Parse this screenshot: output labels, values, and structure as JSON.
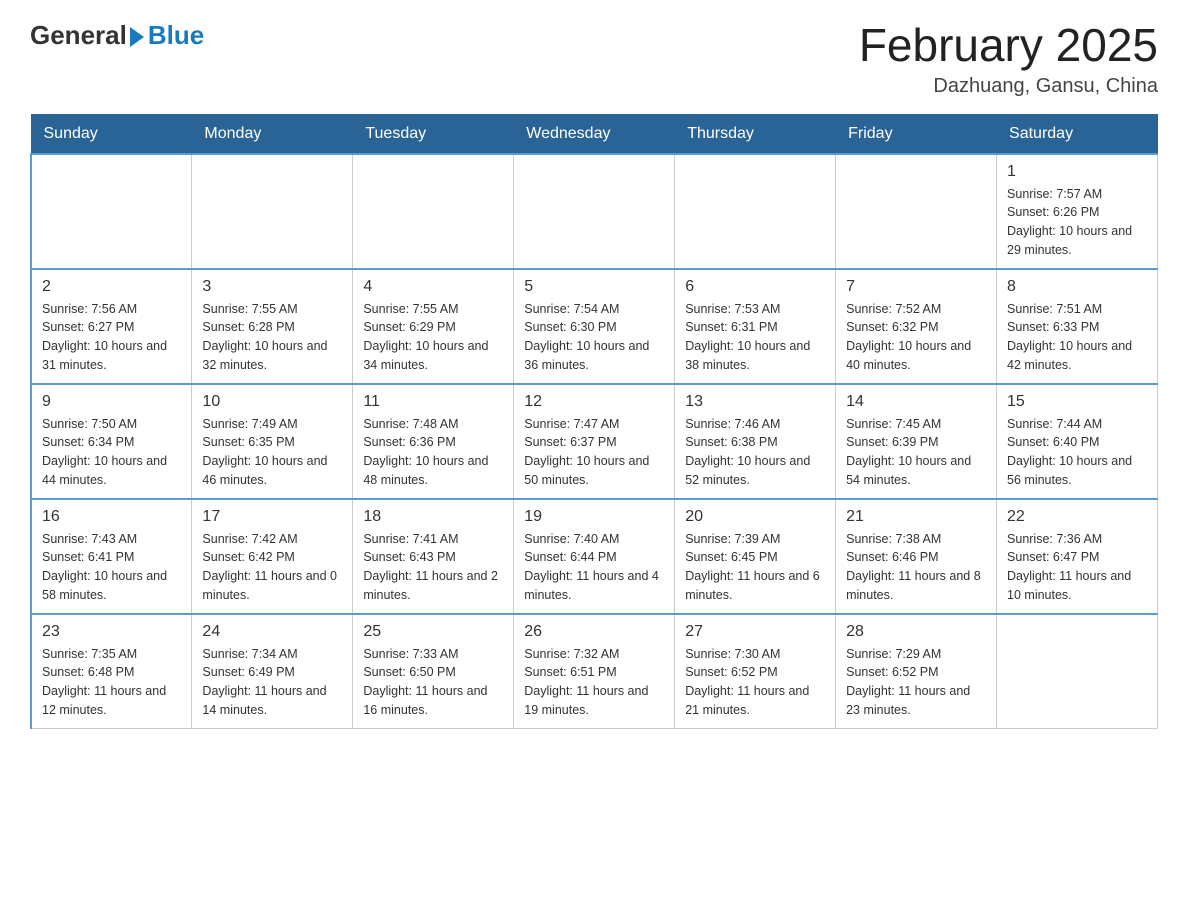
{
  "header": {
    "logo_general": "General",
    "logo_blue": "Blue",
    "month_year": "February 2025",
    "location": "Dazhuang, Gansu, China"
  },
  "weekdays": [
    "Sunday",
    "Monday",
    "Tuesday",
    "Wednesday",
    "Thursday",
    "Friday",
    "Saturday"
  ],
  "weeks": [
    [
      {
        "day": "",
        "sunrise": "",
        "sunset": "",
        "daylight": ""
      },
      {
        "day": "",
        "sunrise": "",
        "sunset": "",
        "daylight": ""
      },
      {
        "day": "",
        "sunrise": "",
        "sunset": "",
        "daylight": ""
      },
      {
        "day": "",
        "sunrise": "",
        "sunset": "",
        "daylight": ""
      },
      {
        "day": "",
        "sunrise": "",
        "sunset": "",
        "daylight": ""
      },
      {
        "day": "",
        "sunrise": "",
        "sunset": "",
        "daylight": ""
      },
      {
        "day": "1",
        "sunrise": "Sunrise: 7:57 AM",
        "sunset": "Sunset: 6:26 PM",
        "daylight": "Daylight: 10 hours and 29 minutes."
      }
    ],
    [
      {
        "day": "2",
        "sunrise": "Sunrise: 7:56 AM",
        "sunset": "Sunset: 6:27 PM",
        "daylight": "Daylight: 10 hours and 31 minutes."
      },
      {
        "day": "3",
        "sunrise": "Sunrise: 7:55 AM",
        "sunset": "Sunset: 6:28 PM",
        "daylight": "Daylight: 10 hours and 32 minutes."
      },
      {
        "day": "4",
        "sunrise": "Sunrise: 7:55 AM",
        "sunset": "Sunset: 6:29 PM",
        "daylight": "Daylight: 10 hours and 34 minutes."
      },
      {
        "day": "5",
        "sunrise": "Sunrise: 7:54 AM",
        "sunset": "Sunset: 6:30 PM",
        "daylight": "Daylight: 10 hours and 36 minutes."
      },
      {
        "day": "6",
        "sunrise": "Sunrise: 7:53 AM",
        "sunset": "Sunset: 6:31 PM",
        "daylight": "Daylight: 10 hours and 38 minutes."
      },
      {
        "day": "7",
        "sunrise": "Sunrise: 7:52 AM",
        "sunset": "Sunset: 6:32 PM",
        "daylight": "Daylight: 10 hours and 40 minutes."
      },
      {
        "day": "8",
        "sunrise": "Sunrise: 7:51 AM",
        "sunset": "Sunset: 6:33 PM",
        "daylight": "Daylight: 10 hours and 42 minutes."
      }
    ],
    [
      {
        "day": "9",
        "sunrise": "Sunrise: 7:50 AM",
        "sunset": "Sunset: 6:34 PM",
        "daylight": "Daylight: 10 hours and 44 minutes."
      },
      {
        "day": "10",
        "sunrise": "Sunrise: 7:49 AM",
        "sunset": "Sunset: 6:35 PM",
        "daylight": "Daylight: 10 hours and 46 minutes."
      },
      {
        "day": "11",
        "sunrise": "Sunrise: 7:48 AM",
        "sunset": "Sunset: 6:36 PM",
        "daylight": "Daylight: 10 hours and 48 minutes."
      },
      {
        "day": "12",
        "sunrise": "Sunrise: 7:47 AM",
        "sunset": "Sunset: 6:37 PM",
        "daylight": "Daylight: 10 hours and 50 minutes."
      },
      {
        "day": "13",
        "sunrise": "Sunrise: 7:46 AM",
        "sunset": "Sunset: 6:38 PM",
        "daylight": "Daylight: 10 hours and 52 minutes."
      },
      {
        "day": "14",
        "sunrise": "Sunrise: 7:45 AM",
        "sunset": "Sunset: 6:39 PM",
        "daylight": "Daylight: 10 hours and 54 minutes."
      },
      {
        "day": "15",
        "sunrise": "Sunrise: 7:44 AM",
        "sunset": "Sunset: 6:40 PM",
        "daylight": "Daylight: 10 hours and 56 minutes."
      }
    ],
    [
      {
        "day": "16",
        "sunrise": "Sunrise: 7:43 AM",
        "sunset": "Sunset: 6:41 PM",
        "daylight": "Daylight: 10 hours and 58 minutes."
      },
      {
        "day": "17",
        "sunrise": "Sunrise: 7:42 AM",
        "sunset": "Sunset: 6:42 PM",
        "daylight": "Daylight: 11 hours and 0 minutes."
      },
      {
        "day": "18",
        "sunrise": "Sunrise: 7:41 AM",
        "sunset": "Sunset: 6:43 PM",
        "daylight": "Daylight: 11 hours and 2 minutes."
      },
      {
        "day": "19",
        "sunrise": "Sunrise: 7:40 AM",
        "sunset": "Sunset: 6:44 PM",
        "daylight": "Daylight: 11 hours and 4 minutes."
      },
      {
        "day": "20",
        "sunrise": "Sunrise: 7:39 AM",
        "sunset": "Sunset: 6:45 PM",
        "daylight": "Daylight: 11 hours and 6 minutes."
      },
      {
        "day": "21",
        "sunrise": "Sunrise: 7:38 AM",
        "sunset": "Sunset: 6:46 PM",
        "daylight": "Daylight: 11 hours and 8 minutes."
      },
      {
        "day": "22",
        "sunrise": "Sunrise: 7:36 AM",
        "sunset": "Sunset: 6:47 PM",
        "daylight": "Daylight: 11 hours and 10 minutes."
      }
    ],
    [
      {
        "day": "23",
        "sunrise": "Sunrise: 7:35 AM",
        "sunset": "Sunset: 6:48 PM",
        "daylight": "Daylight: 11 hours and 12 minutes."
      },
      {
        "day": "24",
        "sunrise": "Sunrise: 7:34 AM",
        "sunset": "Sunset: 6:49 PM",
        "daylight": "Daylight: 11 hours and 14 minutes."
      },
      {
        "day": "25",
        "sunrise": "Sunrise: 7:33 AM",
        "sunset": "Sunset: 6:50 PM",
        "daylight": "Daylight: 11 hours and 16 minutes."
      },
      {
        "day": "26",
        "sunrise": "Sunrise: 7:32 AM",
        "sunset": "Sunset: 6:51 PM",
        "daylight": "Daylight: 11 hours and 19 minutes."
      },
      {
        "day": "27",
        "sunrise": "Sunrise: 7:30 AM",
        "sunset": "Sunset: 6:52 PM",
        "daylight": "Daylight: 11 hours and 21 minutes."
      },
      {
        "day": "28",
        "sunrise": "Sunrise: 7:29 AM",
        "sunset": "Sunset: 6:52 PM",
        "daylight": "Daylight: 11 hours and 23 minutes."
      },
      {
        "day": "",
        "sunrise": "",
        "sunset": "",
        "daylight": ""
      }
    ]
  ]
}
